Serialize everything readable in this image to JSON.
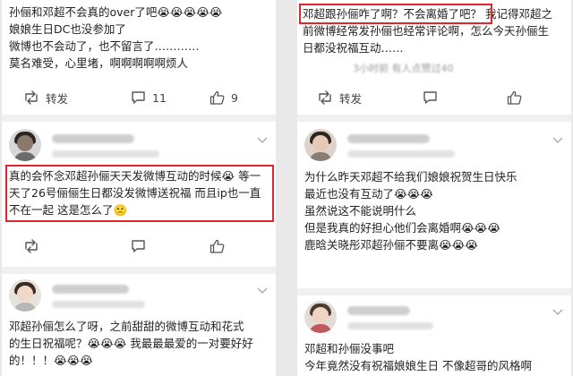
{
  "left": {
    "post1": {
      "lines": [
        "孙俪和邓超不会真的over了吧😭😭😭😭😭",
        "娘娘生日DC也没参加了",
        "微博也不会动了，也不留言了…………",
        "莫名难受，心里堵，啊啊啊啊啊烦人"
      ],
      "repost_label": "转发",
      "comment_count": "11",
      "like_count": "9"
    },
    "post2": {
      "lines": [
        "真的会怀念邓超孙俪天天发微博互动的时候😭 等一",
        "天了26号俪俪生日都没发微博送祝福 而且ip也一直",
        "不在一起 这是怎么了🙁"
      ]
    },
    "post3": {
      "lines": [
        "邓超孙俪怎么了呀，之前甜甜的微博互动和花式",
        "的生日祝福呢？😭😭😭 我最最最爱的一对要好好",
        "的！！！😭😭😭"
      ]
    }
  },
  "right": {
    "post1": {
      "highlight": "邓超跟孙俪咋了啊？不会离婚了吧？",
      "line1_rest": "我记得邓超之",
      "lines": [
        "前微博经常发孙俪也经常评论啊，怎么今天孙俪生",
        "日都没祝福互动……"
      ],
      "meta": "3小时前  有人点赞过40",
      "repost_label": "转发"
    },
    "post2": {
      "lines": [
        "为什么昨天邓超不给我们娘娘祝贺生日快乐",
        " 最近也没有互动了😭😭😭",
        "虽然说这不能说明什么",
        "但是我真的好担心他们会离婚啊😭😭😭",
        "鹿晗关晓彤邓超孙俪不要离😭😭😭"
      ]
    },
    "post3": {
      "lines": [
        "邓超和孙俪没事吧",
        "今年竟然没有祝福娘娘生日 不像超哥的风格啊"
      ]
    }
  },
  "colors": {
    "highlight_border": "#e0262d",
    "separator": "#f0f0f0",
    "icon": "#555555"
  }
}
